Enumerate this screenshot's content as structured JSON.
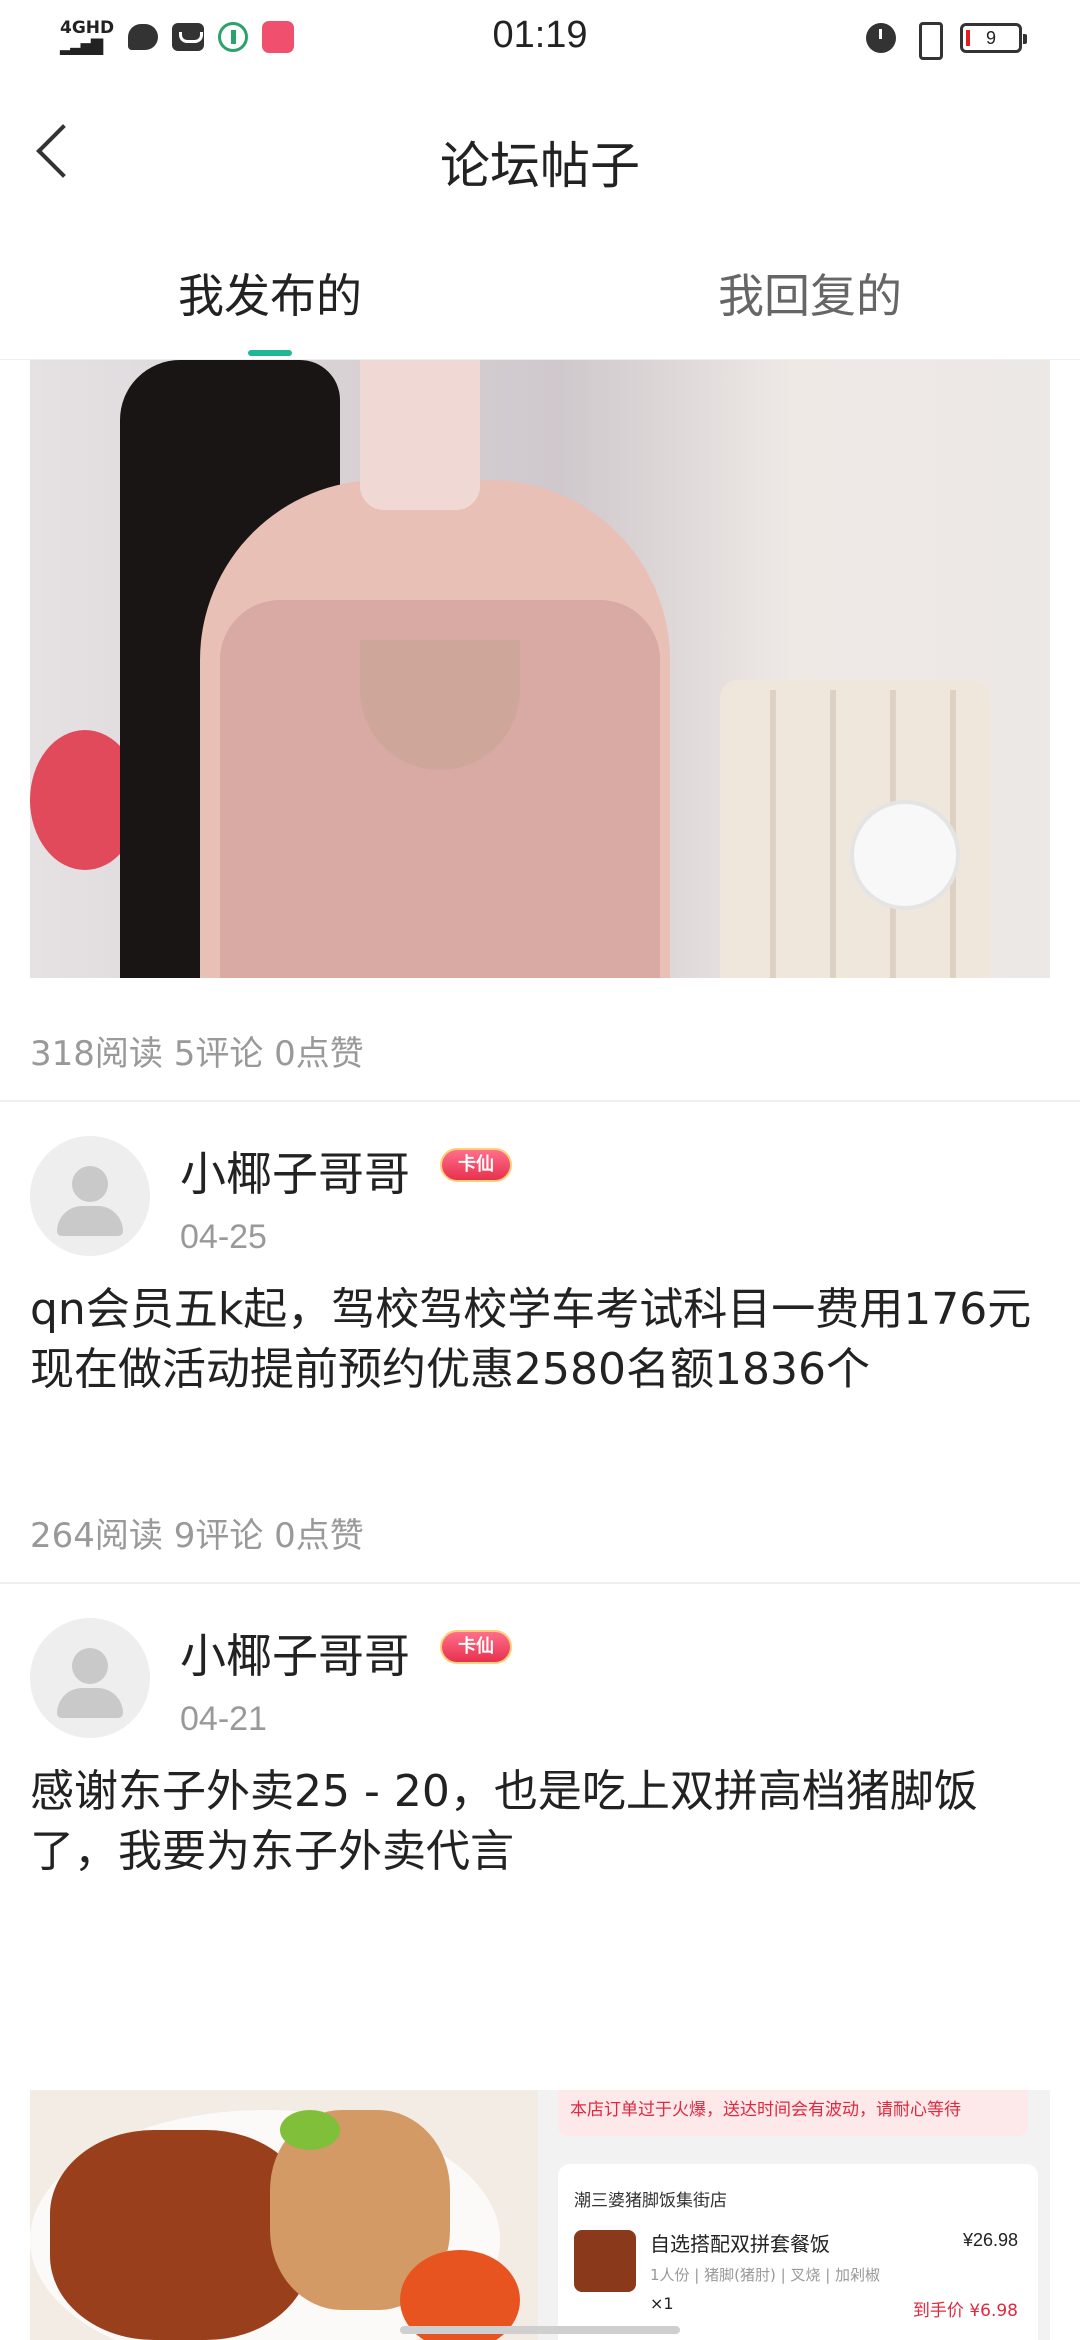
{
  "status_bar": {
    "network": "4GHD",
    "time": "01:19",
    "battery": "9"
  },
  "header": {
    "title": "论坛帖子"
  },
  "tabs": [
    {
      "label": "我发布的",
      "active": true
    },
    {
      "label": "我回复的",
      "active": false
    }
  ],
  "colors": {
    "accent": "#21b795",
    "stats_text": "#999999",
    "badge": "#e8304e"
  },
  "posts": [
    {
      "has_image": true,
      "stats": "318阅读 5评论 0点赞"
    },
    {
      "username": "小椰子哥哥",
      "badge": "卡仙",
      "date": "04-25",
      "text": "qn会员五k起，驾校驾校学车考试科目一费用176元现在做活动提前预约优惠2580名额1836个",
      "stats": "264阅读 9评论 0点赞"
    },
    {
      "username": "小椰子哥哥",
      "badge": "卡仙",
      "date": "04-21",
      "text": "感谢东子外卖25 - 20，也是吃上双拼高档猪脚饭了，我要为东子外卖代言",
      "image_order": {
        "warning": "本店订单过于火爆，送达时间会有波动，请耐心等待",
        "store": "潮三婆猪脚饭集街店",
        "item": "自选搭配双拼套餐饭",
        "price": "¥26.98",
        "spec": "1人份 | 猪脚(猪肘) | 叉烧 | 加剁椒",
        "qty": "×1",
        "pay": "到手价 ¥6.98"
      }
    }
  ]
}
